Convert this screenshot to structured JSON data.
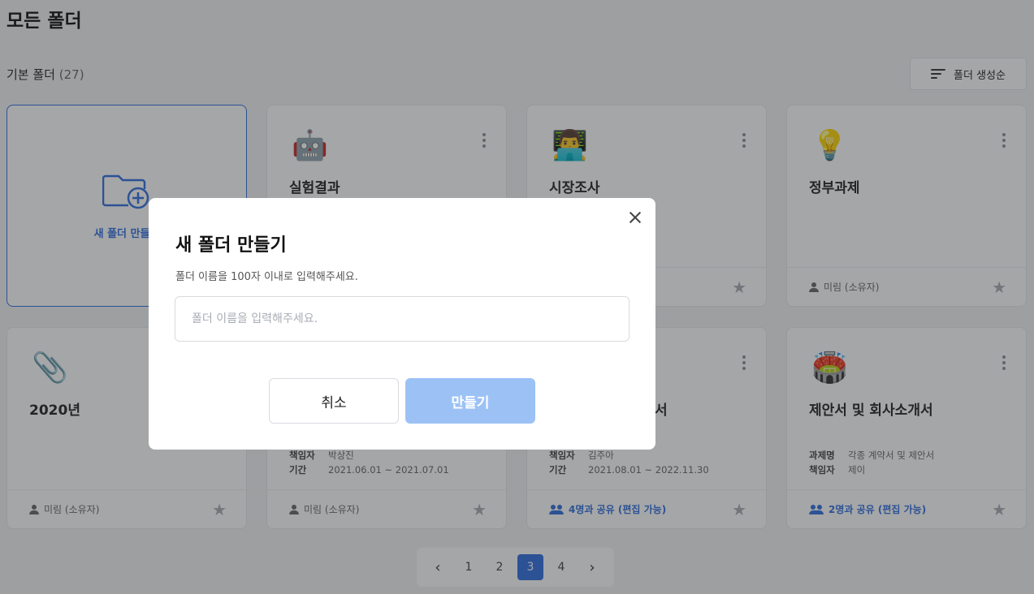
{
  "page": {
    "title": "모든 폴더"
  },
  "section": {
    "label": "기본 폴더",
    "count": "(27)"
  },
  "sort": {
    "label": "폴더 생성순",
    "icon": "sort-icon"
  },
  "new_folder_card": {
    "label": "새 폴더 만들기",
    "icon": "folder-plus-icon"
  },
  "cards": [
    {
      "emoji": "🤖",
      "name": "실험결과",
      "footer": "",
      "shared": false
    },
    {
      "emoji": "👨‍💻",
      "name": "시장조사",
      "footer": "",
      "shared": false
    },
    {
      "emoji": "💡",
      "name": "정부과제",
      "footer": "미림 (소유자)",
      "shared": false
    },
    {
      "emoji": "📎",
      "name": "2020년",
      "footer": "미림 (소유자)",
      "shared": false
    },
    {
      "emoji": "",
      "name": "",
      "meta": [
        {
          "k": "책임자",
          "v": "박상진"
        },
        {
          "k": "기간",
          "v": "2021.06.01 ~ 2021.07.01"
        }
      ],
      "footer": "미림 (소유자)",
      "shared": false
    },
    {
      "emoji": "",
      "name": "서",
      "meta": [
        {
          "k": "책임자",
          "v": "김주아"
        },
        {
          "k": "기간",
          "v": "2021.08.01 ~ 2022.11.30"
        }
      ],
      "footer": "4명과 공유 (편집 가능)",
      "shared": true
    },
    {
      "emoji": "🏟️",
      "name": "제안서 및 회사소개서",
      "meta": [
        {
          "k": "과제명",
          "v": "각종 계약서 및 제안서"
        },
        {
          "k": "책임자",
          "v": "제이"
        }
      ],
      "footer": "2명과 공유 (편집 가능)",
      "shared": true
    }
  ],
  "pagination": {
    "prev": "‹",
    "pages": [
      "1",
      "2",
      "3",
      "4"
    ],
    "active": "3",
    "next": "›"
  },
  "modal": {
    "title": "새 폴더 만들기",
    "description": "폴더 이름을 100자 이내로 입력해주세요.",
    "input_placeholder": "폴더 이름을 입력해주세요.",
    "input_value": "",
    "cancel_label": "취소",
    "create_label": "만들기"
  },
  "colors": {
    "accent": "#2f6fe0",
    "disabled_button": "#9cc2f5",
    "overlay": "rgba(40,42,46,0.42)"
  }
}
